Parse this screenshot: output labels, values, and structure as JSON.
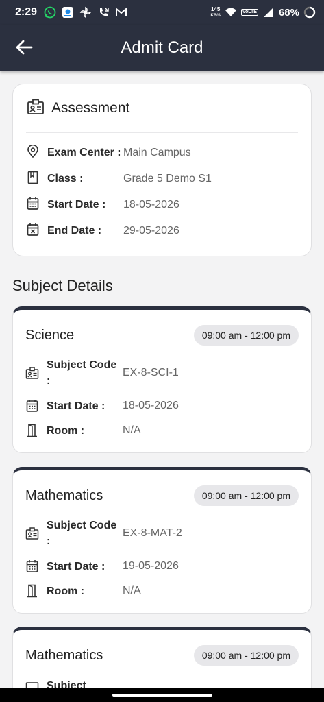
{
  "status_bar": {
    "time": "2:29",
    "net_speed_value": "145",
    "net_speed_unit": "KB/S",
    "volte": "VoLTE",
    "battery": "68%",
    "icons": [
      "whatsapp-icon",
      "app-notification-icon",
      "pinwheel-icon",
      "missed-call-icon",
      "gmail-icon",
      "wifi-icon",
      "signal-icon",
      "battery-ring-icon"
    ]
  },
  "app_bar": {
    "title": "Admit Card",
    "back_icon": "arrow-left-icon"
  },
  "assessment": {
    "title": "Assessment",
    "icon": "id-badge-icon",
    "rows": [
      {
        "icon": "location-pin-icon",
        "label": "Exam Center :",
        "value": "Main Campus"
      },
      {
        "icon": "bookmark-book-icon",
        "label": "Class :",
        "value": "Grade 5 Demo S1"
      },
      {
        "icon": "calendar-icon",
        "label": "Start Date :",
        "value": "18-05-2026"
      },
      {
        "icon": "calendar-x-icon",
        "label": "End Date :",
        "value": "29-05-2026"
      }
    ]
  },
  "subject_details": {
    "title": "Subject Details",
    "subjects": [
      {
        "name": "Science",
        "time": "09:00 am - 12:00 pm",
        "code_label": "Subject Code :",
        "code": "EX-8-SCI-1",
        "start_label": "Start Date :",
        "start": "18-05-2026",
        "room_label": "Room :",
        "room": "N/A"
      },
      {
        "name": "Mathematics",
        "time": "09:00 am - 12:00 pm",
        "code_label": "Subject Code :",
        "code": "EX-8-MAT-2",
        "start_label": "Start Date :",
        "start": "19-05-2026",
        "room_label": "Room :",
        "room": "N/A"
      },
      {
        "name": "Mathematics",
        "time": "09:00 am - 12:00 pm",
        "code_label": "Subject"
      }
    ]
  },
  "colors": {
    "header": "#2b303f",
    "background": "#f3f3f4",
    "card": "#ffffff",
    "pill": "#e7e7ea"
  }
}
